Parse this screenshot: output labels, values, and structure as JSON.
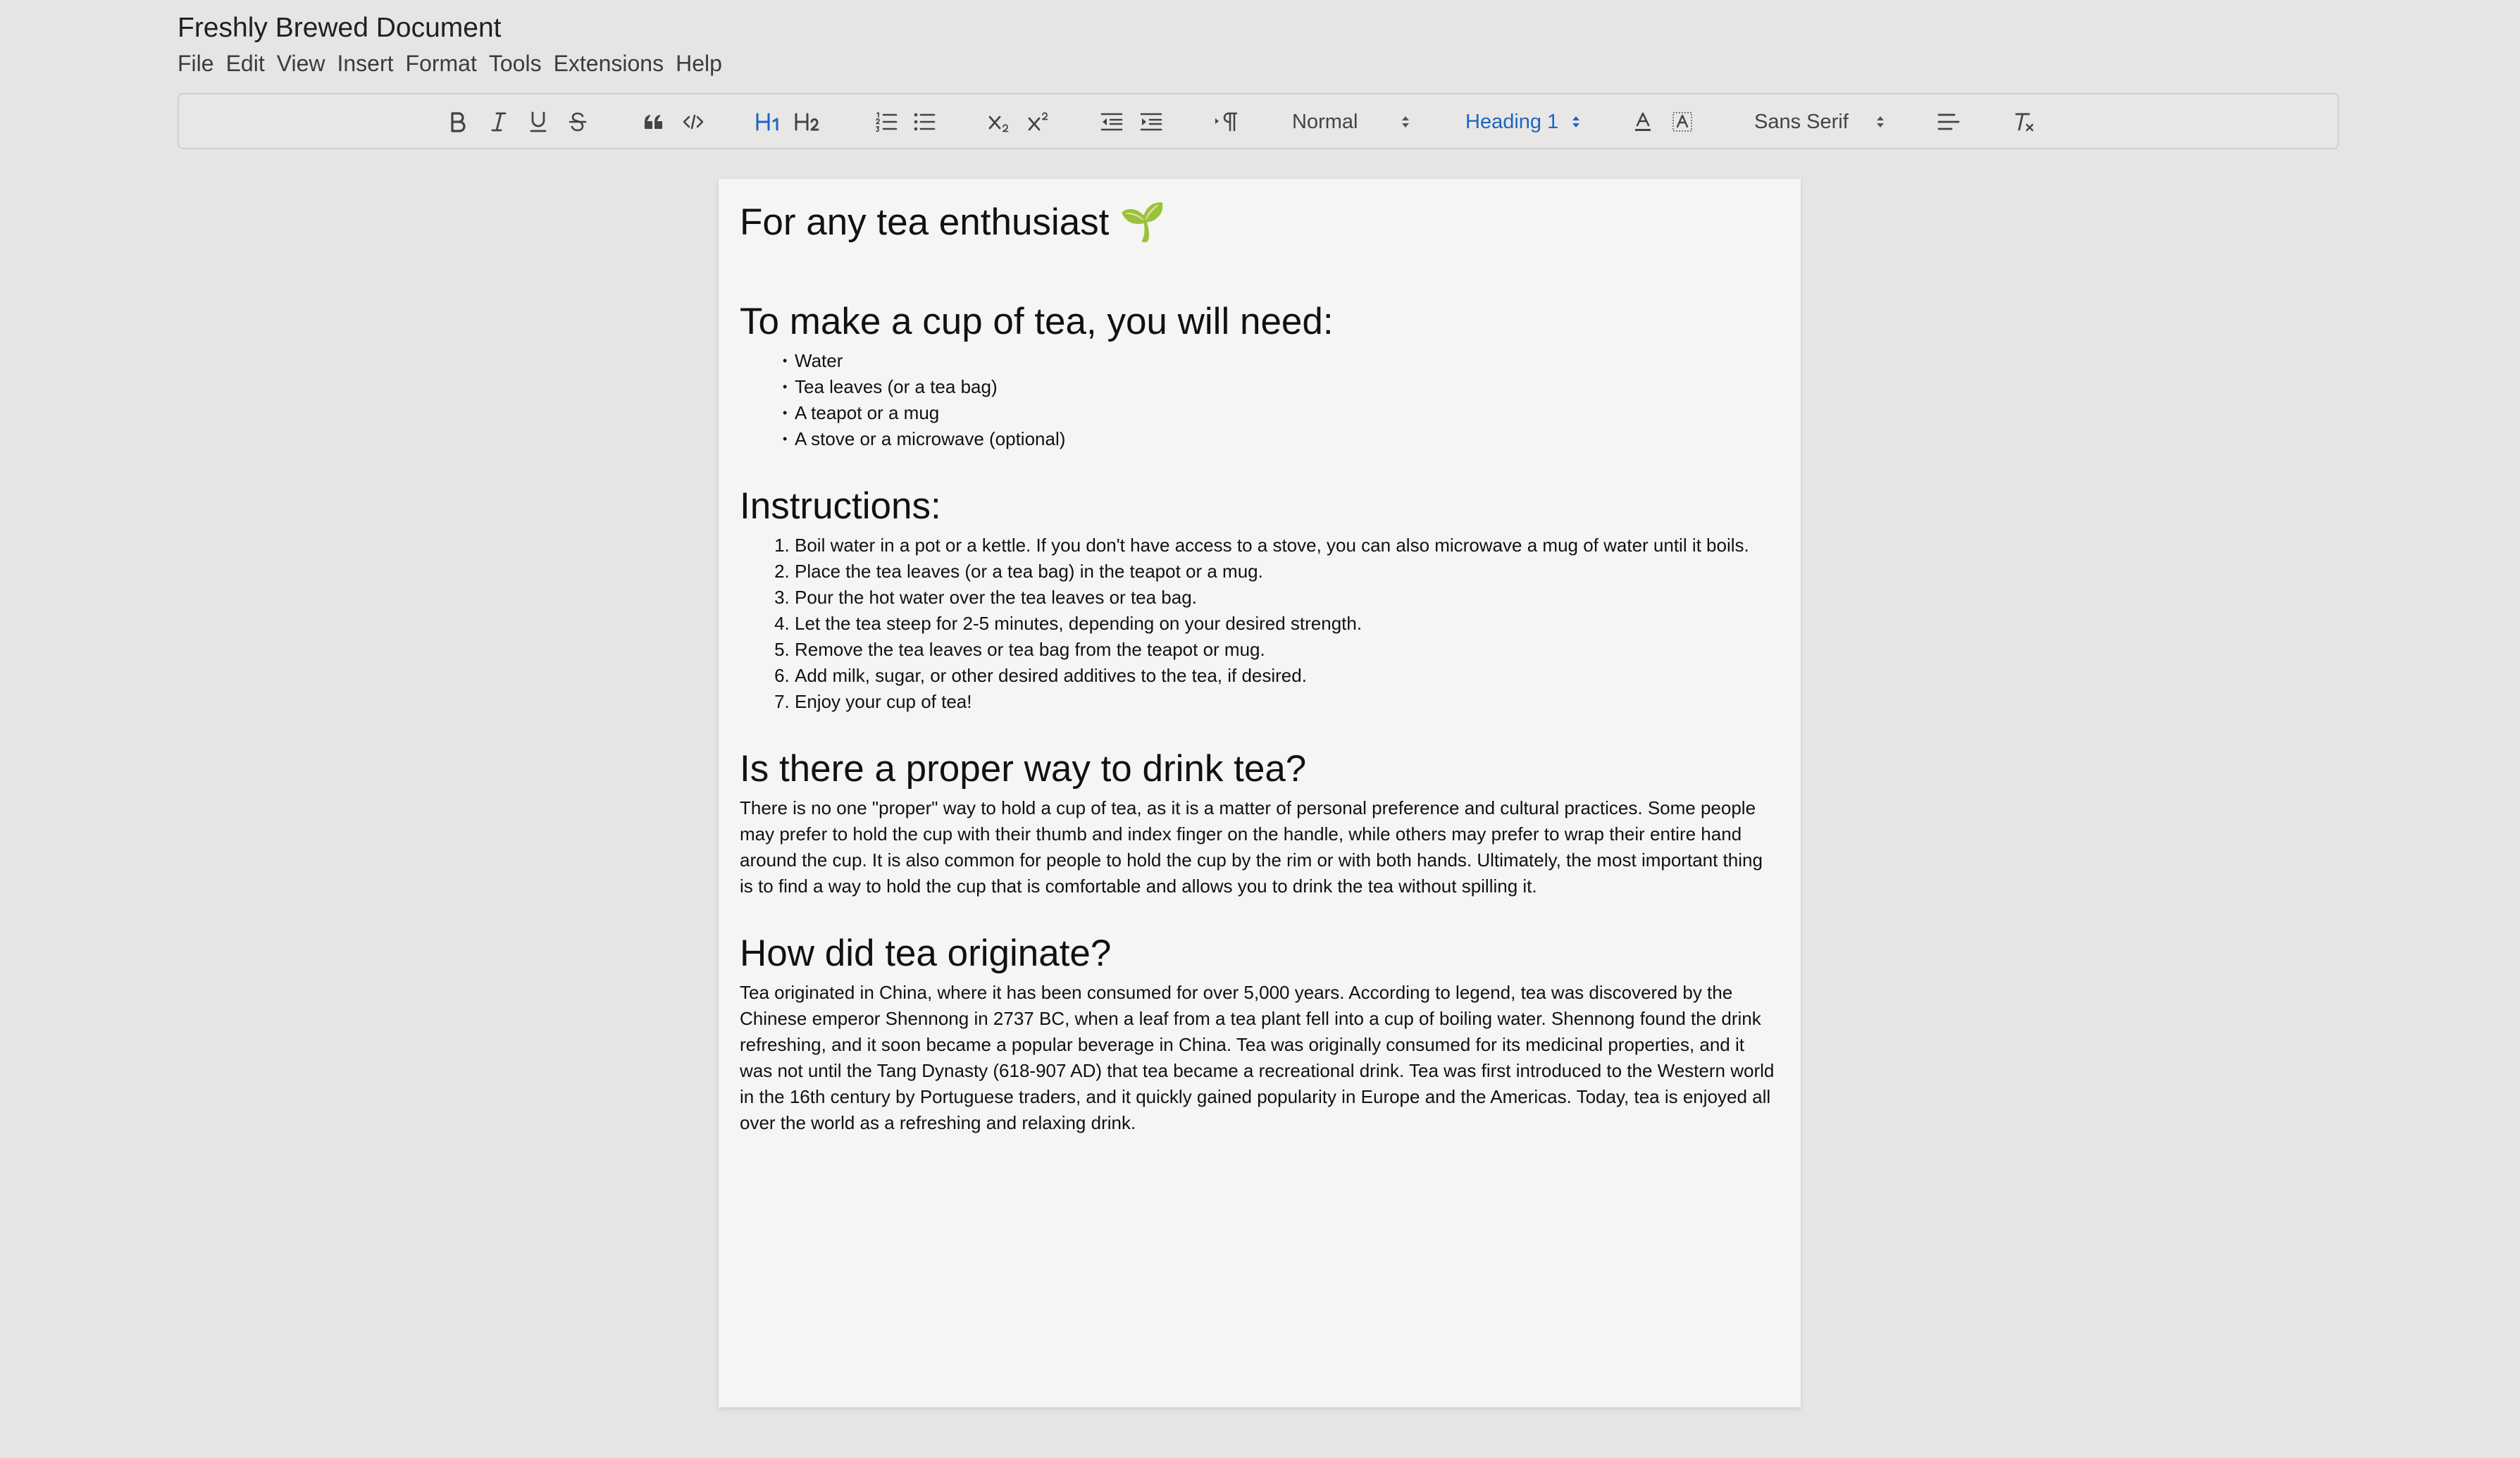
{
  "app": {
    "document_title": "Freshly Brewed Document"
  },
  "menu": {
    "items": [
      "File",
      "Edit",
      "View",
      "Insert",
      "Format",
      "Tools",
      "Extensions",
      "Help"
    ]
  },
  "toolbar": {
    "heading_button_1": "H1",
    "heading_button_2": "H2",
    "paragraph_style": "Normal",
    "heading_select": "Heading 1",
    "font_select": "Sans Serif",
    "accent_color": "#1d64c8"
  },
  "document": {
    "title": "For any tea enthusiast 🌱",
    "sections": {
      "needs": {
        "heading": "To make a cup of tea, you will need:",
        "items": [
          "Water",
          "Tea leaves (or a tea bag)",
          "A teapot or a mug",
          "A stove or a microwave (optional)"
        ]
      },
      "instructions": {
        "heading": "Instructions:",
        "steps": [
          "Boil water in a pot or a kettle. If you don't have access to a stove, you can also microwave a mug of water until it boils.",
          "Place the tea leaves (or a tea bag) in the teapot or a mug.",
          "Pour the hot water over the tea leaves or tea bag.",
          "Let the tea steep for 2-5 minutes, depending on your desired strength.",
          "Remove the tea leaves or tea bag from the teapot or mug.",
          "Add milk, sugar, or other desired additives to the tea, if desired.",
          "Enjoy your cup of tea!"
        ]
      },
      "proper_way": {
        "heading": "Is there a proper way to drink tea?",
        "text": "There is no one \"proper\" way to hold a cup of tea, as it is a matter of personal preference and cultural practices. Some people may prefer to hold the cup with their thumb and index finger on the handle, while others may prefer to wrap their entire hand around the cup. It is also common for people to hold the cup by the rim or with both hands. Ultimately, the most important thing is to find a way to hold the cup that is comfortable and allows you to drink the tea without spilling it."
      },
      "origin": {
        "heading": "How did tea originate?",
        "text": "Tea originated in China, where it has been consumed for over 5,000 years. According to legend, tea was discovered by the Chinese emperor Shennong in 2737 BC, when a leaf from a tea plant fell into a cup of boiling water. Shennong found the drink refreshing, and it soon became a popular beverage in China. Tea was originally consumed for its medicinal properties, and it was not until the Tang Dynasty (618-907 AD) that tea became a recreational drink. Tea was first introduced to the Western world in the 16th century by Portuguese traders, and it quickly gained popularity in Europe and the Americas. Today, tea is enjoyed all over the world as a refreshing and relaxing drink."
      }
    }
  }
}
